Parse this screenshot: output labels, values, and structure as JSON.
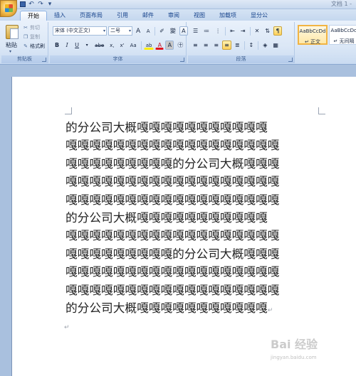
{
  "window": {
    "doc_title": "文档 1 - "
  },
  "tabs": [
    "开始",
    "插入",
    "页面布局",
    "引用",
    "邮件",
    "审阅",
    "视图",
    "加载项",
    "显分公"
  ],
  "clipboard": {
    "paste": "粘贴",
    "cut": "剪切",
    "copy": "复制",
    "format_painter": "格式刷",
    "group": "剪贴板"
  },
  "font": {
    "name": "宋体 (中文正文)",
    "size": "二号",
    "grow": "A",
    "shrink": "A",
    "bold": "B",
    "italic": "I",
    "underline": "U",
    "strike": "abe",
    "subscript": "x,",
    "superscript": "x'",
    "change_case": "Aa",
    "highlight": "ab",
    "font_color": "A",
    "group": "字体"
  },
  "paragraph": {
    "group": "段落"
  },
  "styles": {
    "items": [
      {
        "preview": "AaBbCcDd",
        "name": "↵ 正文"
      },
      {
        "preview": "AaBbCcDd",
        "name": "↵ 无间隔"
      }
    ]
  },
  "document": {
    "lines": [
      "的分公司大概嘎嘎嘎嘎嘎嘎嘎嘎嘎嘎嘎",
      "嘎嘎嘎嘎嘎嘎嘎嘎嘎嘎嘎嘎嘎嘎嘎嘎嘎嘎",
      "嘎嘎嘎嘎嘎嘎嘎嘎嘎的分公司大概嘎嘎嘎",
      "嘎嘎嘎嘎嘎嘎嘎嘎嘎嘎嘎嘎嘎嘎嘎嘎嘎嘎",
      "嘎嘎嘎嘎嘎嘎嘎嘎嘎嘎嘎嘎嘎嘎嘎嘎嘎嘎",
      "的分公司大概嘎嘎嘎嘎嘎嘎嘎嘎嘎嘎嘎",
      "嘎嘎嘎嘎嘎嘎嘎嘎嘎嘎嘎嘎嘎嘎嘎嘎嘎嘎",
      "嘎嘎嘎嘎嘎嘎嘎嘎嘎的分公司大概嘎嘎嘎",
      "嘎嘎嘎嘎嘎嘎嘎嘎嘎嘎嘎嘎嘎嘎嘎嘎嘎嘎",
      "嘎嘎嘎嘎嘎嘎嘎嘎嘎嘎嘎嘎嘎嘎嘎嘎嘎嘎",
      "的分公司大概嘎嘎嘎嘎嘎嘎嘎嘎嘎嘎嘎"
    ]
  },
  "watermark": {
    "text": "Bai 经验",
    "sub": "jingyan.baidu.com"
  }
}
